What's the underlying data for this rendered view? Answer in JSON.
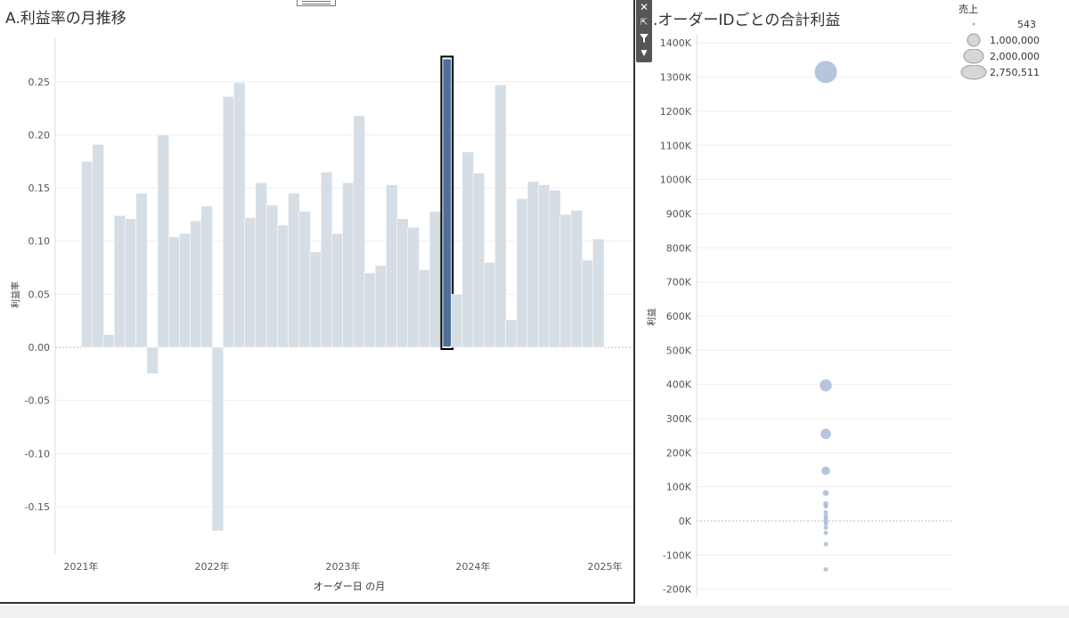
{
  "sheet_a": {
    "title": "A.利益率の月推移",
    "ylabel": "利益率",
    "xlabel": "オーダー日 の月"
  },
  "sheet_b": {
    "title": ".オーダーIDごとの合計利益",
    "ylabel": "利益"
  },
  "toolbar": {
    "close_icon": "close-icon",
    "popout_icon": "popout-icon",
    "filter_icon": "filter-icon",
    "more_icon": "chevron-down-icon"
  },
  "legend": {
    "title": "売上",
    "items": [
      "543",
      "1,000,000",
      "2,000,000",
      "2,750,511"
    ]
  },
  "colors": {
    "bar": "#d5dde5",
    "bar_selected": "#4e6f98",
    "bubble": "#a8bbd6",
    "bubble_dark": "#7f9cc4",
    "grid": "#eeeeee",
    "zero": "#bbbbbb"
  },
  "chart_data": [
    {
      "type": "bar",
      "title": "A.利益率の月推移",
      "xlabel": "オーダー日 の月",
      "ylabel": "利益率",
      "ylim": [
        -0.195,
        0.29
      ],
      "yticks": [
        "0.25",
        "0.20",
        "0.15",
        "0.10",
        "0.05",
        "0.00",
        "-0.05",
        "-0.10",
        "-0.15"
      ],
      "xticks": [
        "2021年",
        "2022年",
        "2023年",
        "2024年",
        "2025年"
      ],
      "months": 48,
      "values": [
        0.175,
        0.191,
        0.012,
        0.124,
        0.121,
        0.145,
        -0.025,
        0.2,
        0.104,
        0.107,
        0.119,
        0.133,
        -0.173,
        0.236,
        0.249,
        0.122,
        0.155,
        0.134,
        0.115,
        0.145,
        0.128,
        0.09,
        0.165,
        0.107,
        0.155,
        0.218,
        0.07,
        0.077,
        0.153,
        0.121,
        0.113,
        0.073,
        0.128,
        0.272,
        0.05,
        0.184,
        0.164,
        0.08,
        0.247,
        0.026,
        0.14,
        0.156,
        0.153,
        0.148,
        0.125,
        0.129,
        0.082,
        0.102
      ],
      "selected_index": 33,
      "grid": true
    },
    {
      "type": "scatter",
      "title": ".オーダーIDごとの合計利益",
      "ylabel": "利益",
      "ylim": [
        -220000,
        1420000
      ],
      "yticks": [
        "1400K",
        "1300K",
        "1200K",
        "1100K",
        "1000K",
        "900K",
        "800K",
        "700K",
        "600K",
        "500K",
        "400K",
        "300K",
        "200K",
        "100K",
        "0K",
        "-100K",
        "-200K"
      ],
      "size_legend_title": "売上",
      "points": [
        {
          "y": 1315000,
          "sales": 2750511
        },
        {
          "y": 397000,
          "sales": 800000
        },
        {
          "y": 255000,
          "sales": 600000
        },
        {
          "y": 147000,
          "sales": 400000
        },
        {
          "y": 82000,
          "sales": 200000
        },
        {
          "y": 50000,
          "sales": 150000
        },
        {
          "y": 43000,
          "sales": 120000
        },
        {
          "y": 25000,
          "sales": 100000
        },
        {
          "y": 15000,
          "sales": 90000
        },
        {
          "y": 8000,
          "sales": 80000
        },
        {
          "y": 0,
          "sales": 70000
        },
        {
          "y": -8000,
          "sales": 50000
        },
        {
          "y": -20000,
          "sales": 30000
        },
        {
          "y": -35000,
          "sales": 20000
        },
        {
          "y": -68000,
          "sales": 10000
        },
        {
          "y": -142000,
          "sales": 8000
        }
      ]
    }
  ]
}
